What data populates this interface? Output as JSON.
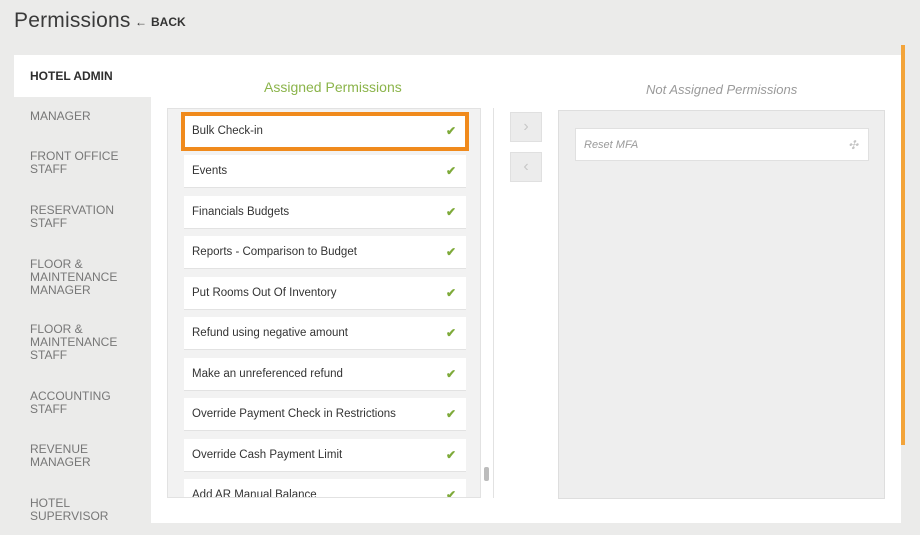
{
  "header": {
    "title": "Permissions",
    "back_label": "BACK"
  },
  "sidebar": {
    "items": [
      {
        "label": "HOTEL ADMIN",
        "active": true
      },
      {
        "label": "MANAGER"
      },
      {
        "label": "FRONT OFFICE STAFF"
      },
      {
        "label": "RESERVATION STAFF"
      },
      {
        "label": "FLOOR & MAINTENANCE MANAGER"
      },
      {
        "label": "FLOOR & MAINTENANCE STAFF"
      },
      {
        "label": "ACCOUNTING STAFF"
      },
      {
        "label": "REVENUE MANAGER"
      },
      {
        "label": "HOTEL SUPERVISOR"
      }
    ]
  },
  "assigned": {
    "title": "Assigned Permissions",
    "items": [
      {
        "label": "Bulk Check-in",
        "highlighted": true
      },
      {
        "label": "Events"
      },
      {
        "label": "Financials Budgets"
      },
      {
        "label": "Reports - Comparison to Budget"
      },
      {
        "label": "Put Rooms Out Of Inventory"
      },
      {
        "label": "Refund using negative amount"
      },
      {
        "label": "Make an unreferenced refund"
      },
      {
        "label": "Override Payment Check in Restrictions"
      },
      {
        "label": "Override Cash Payment Limit"
      },
      {
        "label": "Add AR Manual Balance"
      }
    ],
    "check_icon": "checkmark-icon"
  },
  "controls": {
    "move_right_icon": "chevron-right-icon",
    "move_left_icon": "chevron-left-icon"
  },
  "not_assigned": {
    "title": "Not Assigned Permissions",
    "items": [
      {
        "label": "Reset MFA"
      }
    ],
    "drag_icon": "move-arrows-icon"
  },
  "colors": {
    "accent_orange": "#f08a1c",
    "assigned_green": "#8bb44a",
    "scroll_accent": "#f3a43a"
  }
}
